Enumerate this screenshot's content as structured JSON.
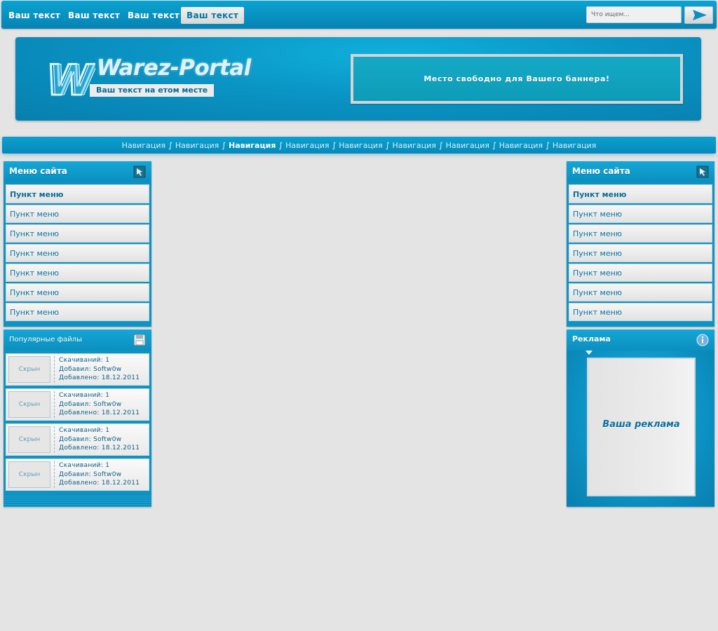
{
  "topnav": {
    "links": [
      "Ваш текст",
      "Ваш текст",
      "Ваш текст",
      "Ваш текст"
    ],
    "search_placeholder": "Что ищем..."
  },
  "header": {
    "logo_letter": "W",
    "logo_title": "Warez-Portal",
    "slogan": "Ваш текст на етом месте",
    "banner_text": "Место свободно для Вашего баннера!"
  },
  "navbar": {
    "separator": "∫",
    "links": [
      "Навигация",
      "Навигация",
      "Навигация",
      "Навигация",
      "Навигация",
      "Навигация",
      "Навигация",
      "Навигация",
      "Навигация"
    ],
    "active_index": 2
  },
  "left_menu": {
    "title": "Меню сайта",
    "items": [
      "Пункт меню",
      "Пункт меню",
      "Пункт меню",
      "Пункт меню",
      "Пункт меню",
      "Пункт меню",
      "Пункт меню"
    ]
  },
  "popular_files": {
    "title": "Популярные файлы",
    "items": [
      {
        "thumb": "Скрын",
        "downloads": "Скачиваний: 1",
        "author": "Добавил: Softw0w",
        "date": "Добавлено: 18.12.2011"
      },
      {
        "thumb": "Скрын",
        "downloads": "Скачиваний: 1",
        "author": "Добавил: Softw0w",
        "date": "Добавлено: 18.12.2011"
      },
      {
        "thumb": "Скрын",
        "downloads": "Скачиваний: 1",
        "author": "Добавил: Softw0w",
        "date": "Добавлено: 18.12.2011"
      },
      {
        "thumb": "Скрын",
        "downloads": "Скачиваний: 1",
        "author": "Добавил: Softw0w",
        "date": "Добавлено: 18.12.2011"
      }
    ]
  },
  "right_menu": {
    "title": "Меню сайта",
    "items": [
      "Пункт меню",
      "Пункт меню",
      "Пункт меню",
      "Пункт меню",
      "Пункт меню",
      "Пункт меню",
      "Пункт меню"
    ]
  },
  "ads": {
    "title": "Реклама",
    "text": "Ваша реклама"
  },
  "icons": {
    "menu_icon": "cursor-arrow-icon",
    "files_icon": "floppy-disk-icon",
    "ads_icon": "info-icon",
    "search_icon": "arrow-right-icon"
  },
  "colors": {
    "accent": "#0a94c4",
    "page_bg": "#e4e4e4",
    "link_text": "#0a76a3"
  }
}
